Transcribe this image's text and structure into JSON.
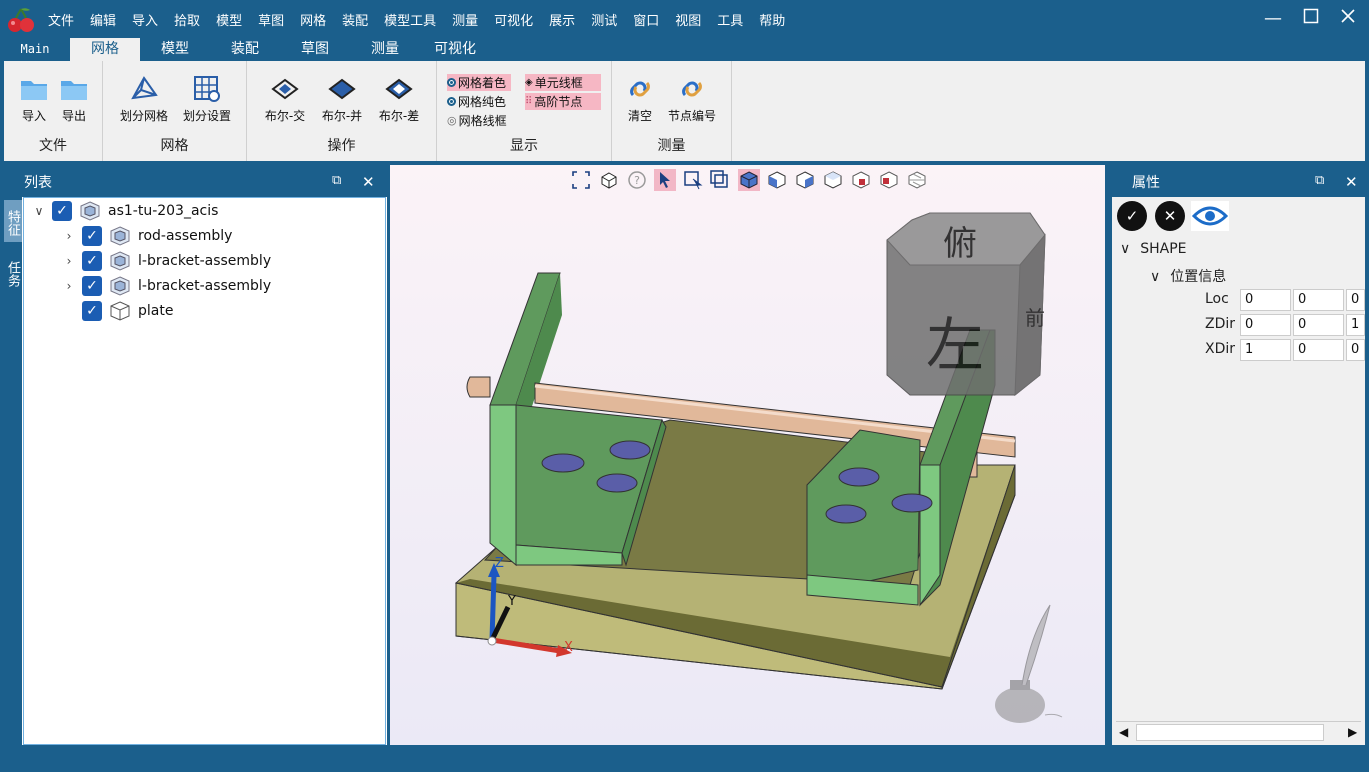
{
  "menu": [
    "文件",
    "编辑",
    "导入",
    "拾取",
    "模型",
    "草图",
    "网格",
    "装配",
    "模型工具",
    "测量",
    "可视化",
    "展示",
    "测试",
    "窗口",
    "视图",
    "工具",
    "帮助"
  ],
  "tabs": [
    "Main",
    "网格",
    "模型",
    "装配",
    "草图",
    "测量",
    "可视化"
  ],
  "active_tab": "网格",
  "ribbon": {
    "groups": [
      {
        "name": "文件",
        "buttons": [
          "导入",
          "导出"
        ]
      },
      {
        "name": "网格",
        "buttons": [
          "划分网格",
          "划分设置"
        ]
      },
      {
        "name": "操作",
        "buttons": [
          "布尔-交",
          "布尔-并",
          "布尔-差"
        ]
      },
      {
        "name": "显示",
        "options": [
          {
            "label": "网格着色",
            "selected": true
          },
          {
            "label": "单元线框"
          },
          {
            "label": "网格纯色",
            "selected": true
          },
          {
            "label": "高阶节点"
          },
          {
            "label": "网格线框"
          }
        ]
      },
      {
        "name": "测量",
        "buttons": [
          "清空",
          "节点编号"
        ]
      }
    ]
  },
  "list_panel": {
    "title": "列表",
    "side_tabs": [
      "特征",
      "任务"
    ],
    "tree": [
      {
        "label": "as1-tu-203_acis",
        "level": 0,
        "expanded": true,
        "checked": true
      },
      {
        "label": "rod-assembly",
        "level": 1,
        "expanded": false,
        "checked": true
      },
      {
        "label": "l-bracket-assembly",
        "level": 1,
        "expanded": false,
        "checked": true
      },
      {
        "label": "l-bracket-assembly",
        "level": 1,
        "expanded": false,
        "checked": true
      },
      {
        "label": "plate",
        "level": 1,
        "checked": true
      }
    ]
  },
  "viewcube": {
    "top": "俯",
    "front": "左",
    "right": "前"
  },
  "axes": {
    "z": "Z",
    "y": "Y",
    "x": "X"
  },
  "properties": {
    "title": "属性",
    "shape": "SHAPE",
    "section": "位置信息",
    "rows": [
      {
        "name": "Loc",
        "values": [
          "0",
          "0",
          "0"
        ]
      },
      {
        "name": "ZDir",
        "values": [
          "0",
          "0",
          "1"
        ]
      },
      {
        "name": "XDir",
        "values": [
          "1",
          "0",
          "0"
        ]
      }
    ]
  },
  "colors": {
    "chrome": "#1b5f8c",
    "bracket": "#6fbd70",
    "plate": "#b5b274",
    "rod": "#e1b89a",
    "pin": "#6a6fb0"
  }
}
